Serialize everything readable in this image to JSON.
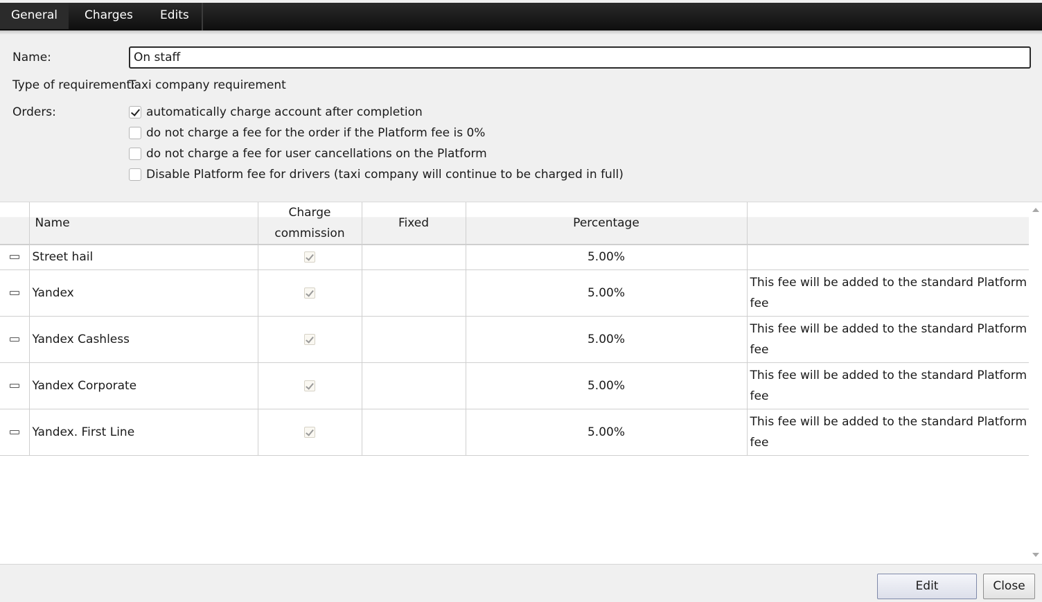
{
  "tabs": [
    {
      "label": "General"
    },
    {
      "label": "Charges"
    },
    {
      "label": "Edits"
    }
  ],
  "form": {
    "name_label": "Name:",
    "name_value": "On staff",
    "type_label": "Type of requirement:",
    "type_value": "Taxi company requirement",
    "orders_label": "Orders:",
    "options": [
      {
        "label": "automatically charge account after completion",
        "checked": true
      },
      {
        "label": "do not charge a fee for the order if the Platform fee is 0%",
        "checked": false
      },
      {
        "label": "do not charge a fee for user cancellations on the Platform",
        "checked": false
      },
      {
        "label": "Disable Platform fee for drivers (taxi company will continue to be charged in full)",
        "checked": false
      }
    ]
  },
  "table": {
    "headers": {
      "name": "Name",
      "charge_line1": "Charge",
      "charge_line2": "commission",
      "fixed": "Fixed",
      "percentage": "Percentage",
      "note": ""
    },
    "rows": [
      {
        "name": "Street hail",
        "charge": true,
        "fixed": "",
        "percentage": "5.00%",
        "note": ""
      },
      {
        "name": "Yandex",
        "charge": true,
        "fixed": "",
        "percentage": "5.00%",
        "note": "This fee will be added to the standard Platform fee"
      },
      {
        "name": "Yandex Cashless",
        "charge": true,
        "fixed": "",
        "percentage": "5.00%",
        "note": "This fee will be added to the standard Platform fee"
      },
      {
        "name": "Yandex Corporate",
        "charge": true,
        "fixed": "",
        "percentage": "5.00%",
        "note": "This fee will be added to the standard Platform fee"
      },
      {
        "name": "Yandex. First Line",
        "charge": true,
        "fixed": "",
        "percentage": "5.00%",
        "note": "This fee will be added to the standard Platform fee"
      }
    ]
  },
  "footer": {
    "edit_label": "Edit",
    "close_label": "Close"
  }
}
